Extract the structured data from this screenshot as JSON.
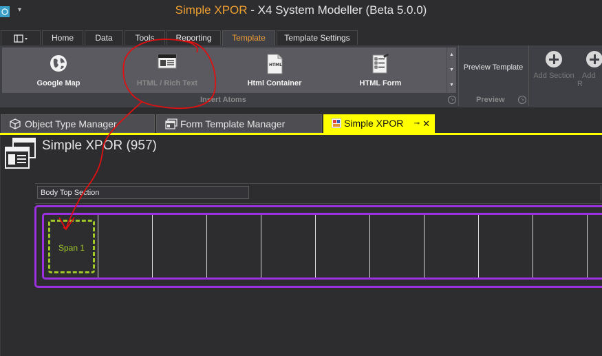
{
  "window": {
    "title_accent": "Simple XPOR",
    "title_rest": " - X4 System Modeller (Beta 5.0.0)"
  },
  "ribbon_tabs": [
    "Home",
    "Data",
    "Tools",
    "Reporting",
    "Template",
    "Template Settings"
  ],
  "active_ribbon_tab": "Template",
  "insert_atoms": {
    "items": [
      "Google Map",
      "HTML / Rich Text",
      "Html Container",
      "HTML Form"
    ],
    "disabled_item": "HTML / Rich Text",
    "group_label": "Insert Atoms"
  },
  "preview": {
    "button_label": "Preview Template",
    "group_label": "Preview"
  },
  "sections": {
    "add_section_label": "Add Section",
    "add_row_label": "Add R"
  },
  "doc_tabs": {
    "items": [
      "Object Type Manager",
      "Form Template Manager",
      "Simple XPOR"
    ],
    "active": "Simple XPOR"
  },
  "page": {
    "title": "Simple XPOR (957)",
    "section_label": "Body Top Section",
    "span_label": "Span 1"
  },
  "colors": {
    "accent_orange": "#f0a030",
    "active_tab_yellow": "#ffff00",
    "section_purple": "#9b30e0",
    "span_green": "#a0c828",
    "annotation_red": "#e01010"
  },
  "icons": {
    "google_map": "globe-icon",
    "html_rich_text": "html-panel-icon",
    "html_container": "html-file-icon",
    "html_form": "form-icon",
    "add": "plus-circle-icon"
  }
}
